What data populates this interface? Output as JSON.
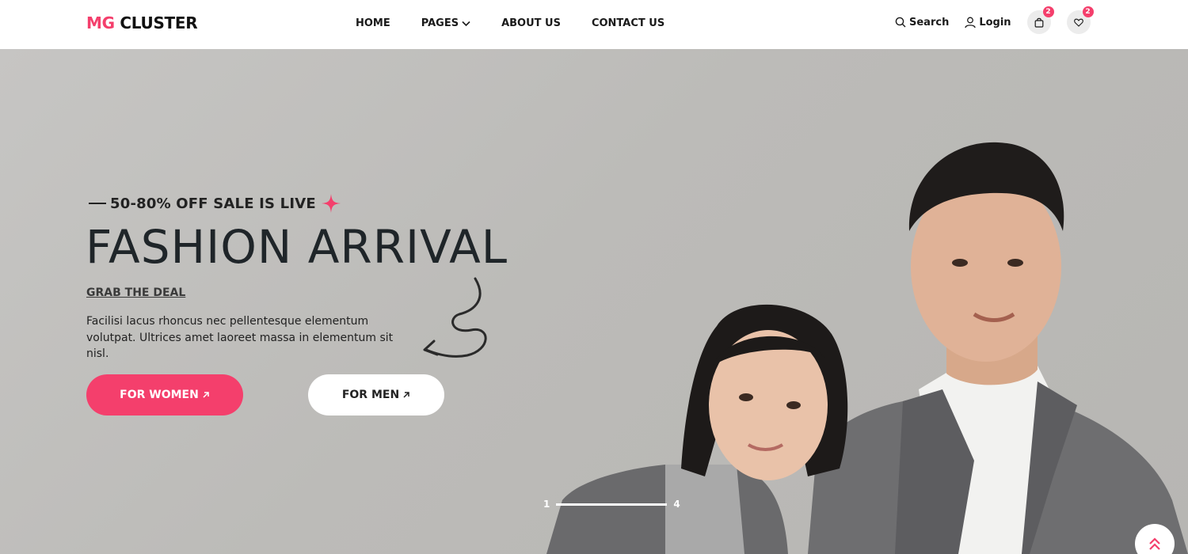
{
  "brand": {
    "prefix": "MG",
    "name": "CLUSTER"
  },
  "nav": {
    "items": [
      {
        "label": "HOME"
      },
      {
        "label": "PAGES",
        "has_dropdown": true
      },
      {
        "label": "ABOUT US"
      },
      {
        "label": "CONTACT US"
      }
    ]
  },
  "tools": {
    "search_label": "Search",
    "login_label": "Login",
    "cart_count": "2",
    "wishlist_count": "2"
  },
  "hero": {
    "sale_text": "50-80% OFF SALE IS LIVE",
    "title": "FASHION ARRIVAL",
    "grab_link": "GRAB THE DEAL",
    "description": "Facilisi lacus rhoncus nec pellentesque elementum volutpat. Ultrices amet laoreet massa in elementum sit nisl.",
    "btn_women": "FOR WOMEN",
    "btn_men": "FOR MEN"
  },
  "pager": {
    "current": "1",
    "total": "4"
  },
  "colors": {
    "accent": "#f43f6c",
    "hero_bg": "#bdbcb9",
    "text_dark": "#1f2529"
  },
  "icons": [
    "search-icon",
    "user-icon",
    "bag-icon",
    "heart-icon",
    "chevron-down-icon",
    "arrow-up-right-icon",
    "sparkle-icon",
    "double-chevron-up-icon"
  ]
}
